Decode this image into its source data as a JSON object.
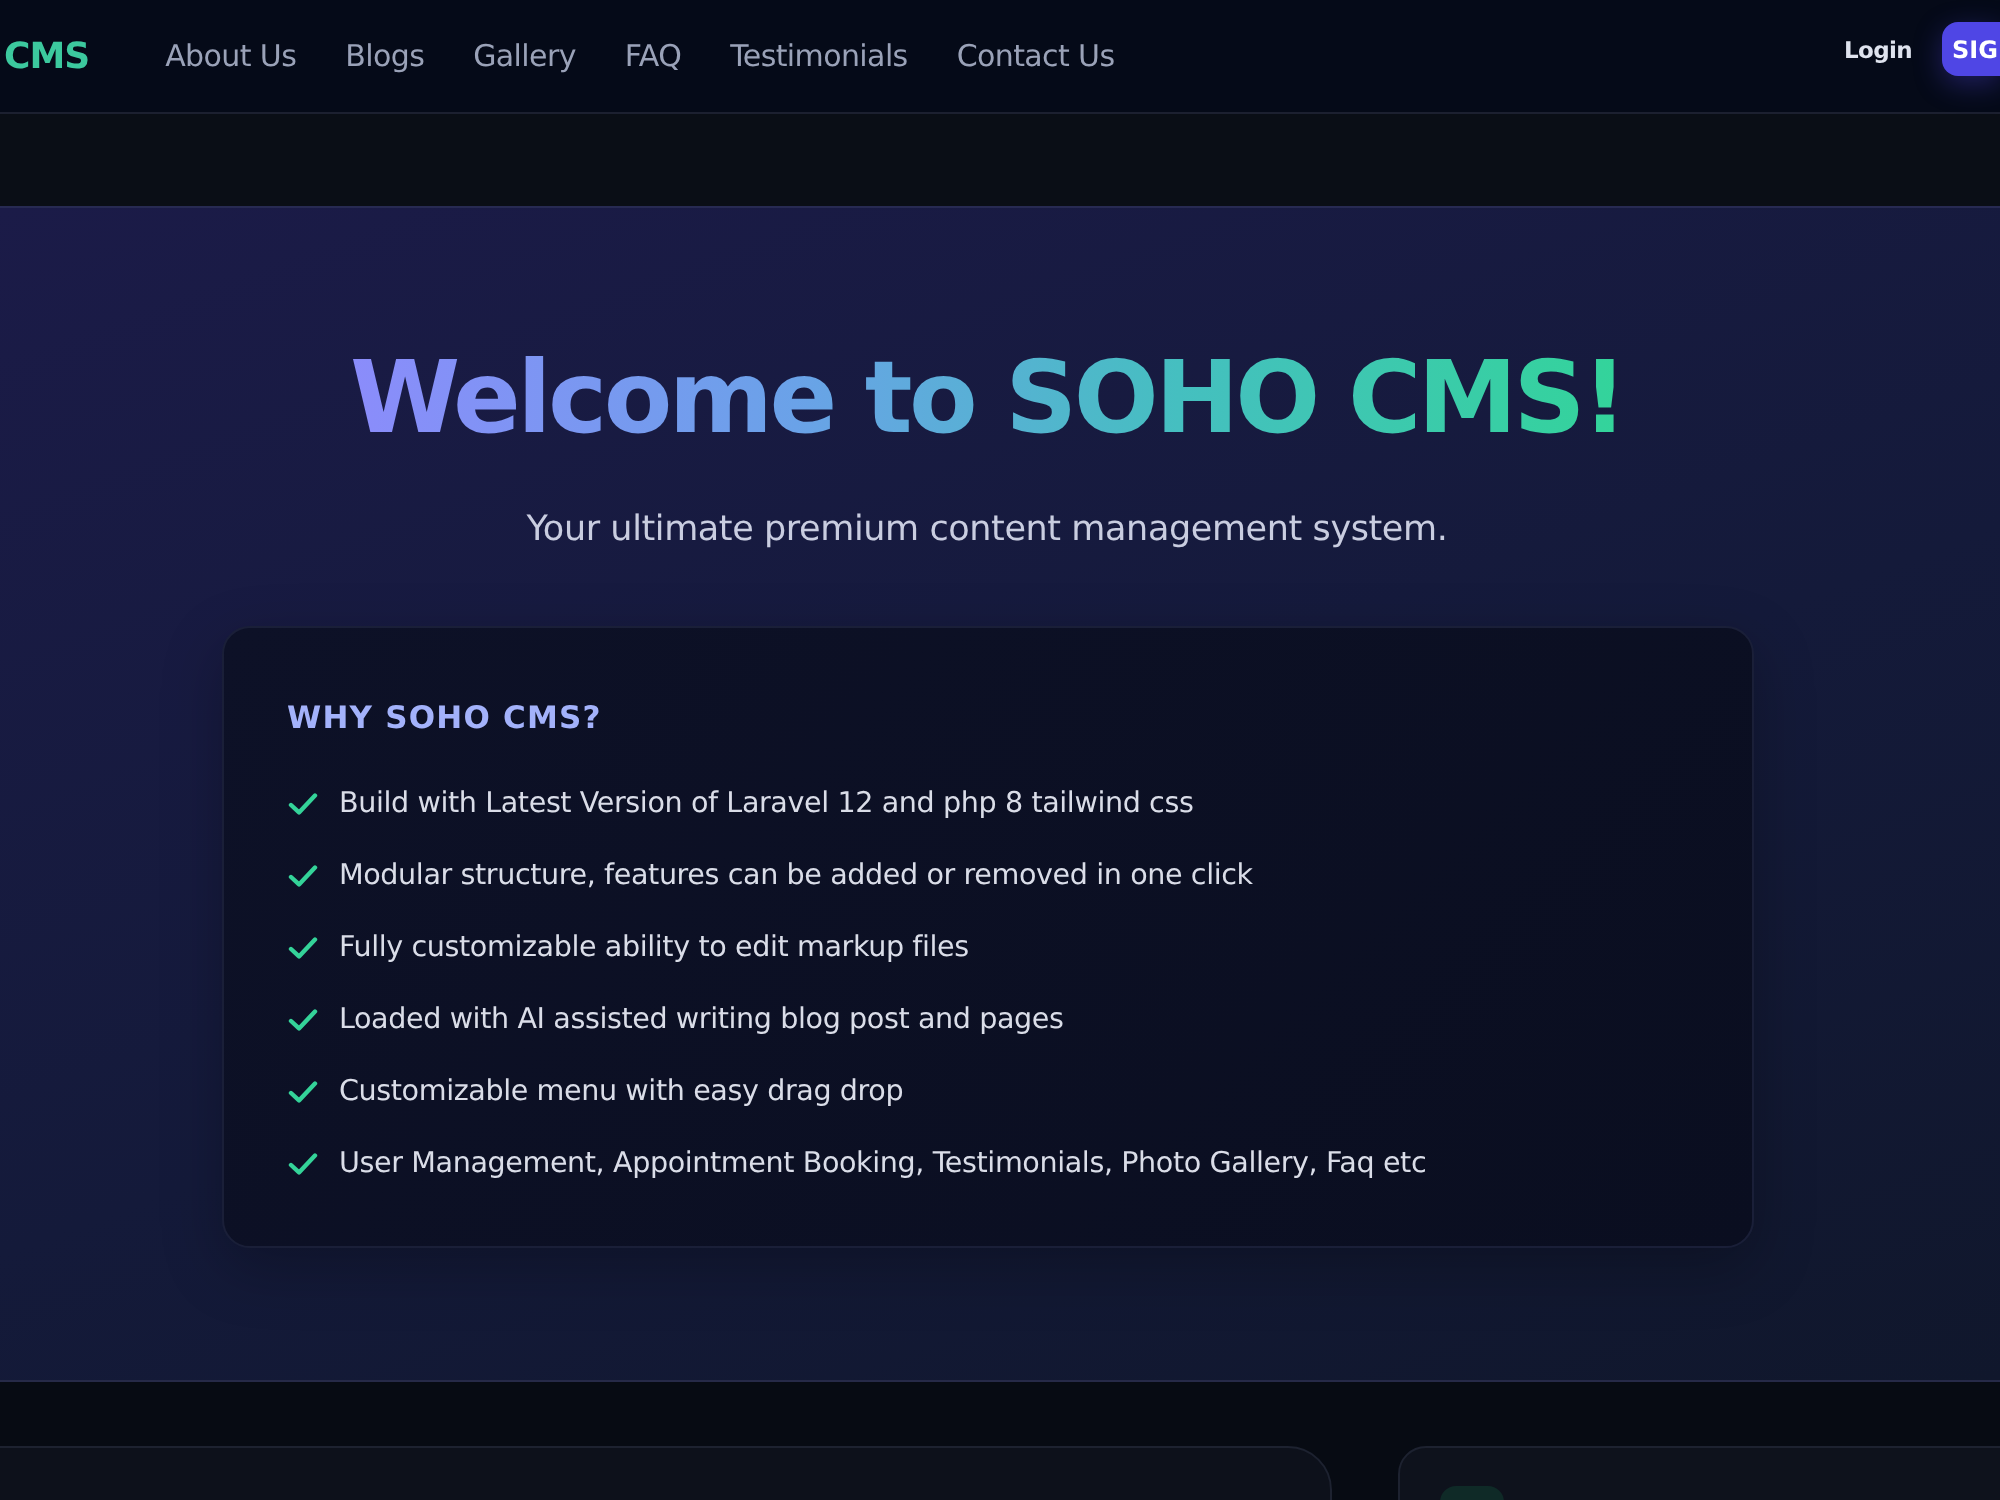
{
  "header": {
    "logo": "CMS",
    "nav": [
      "About Us",
      "Blogs",
      "Gallery",
      "FAQ",
      "Testimonials",
      "Contact Us"
    ],
    "login": "Login",
    "signup": "SIG"
  },
  "hero": {
    "title": "Welcome to SOHO CMS!",
    "subtitle": "Your ultimate premium content management system."
  },
  "features": {
    "heading": "WHY SOHO CMS?",
    "items": [
      "Build with Latest Version of Laravel 12 and php 8 tailwind css",
      "Modular structure, features can be added or removed in one click",
      "Fully customizable ability to edit markup files",
      "Loaded with AI assisted writing blog post and pages",
      "Customizable menu with easy drag drop",
      "User Management, Appointment Booking, Testimonials, Photo Gallery, Faq etc"
    ]
  }
}
